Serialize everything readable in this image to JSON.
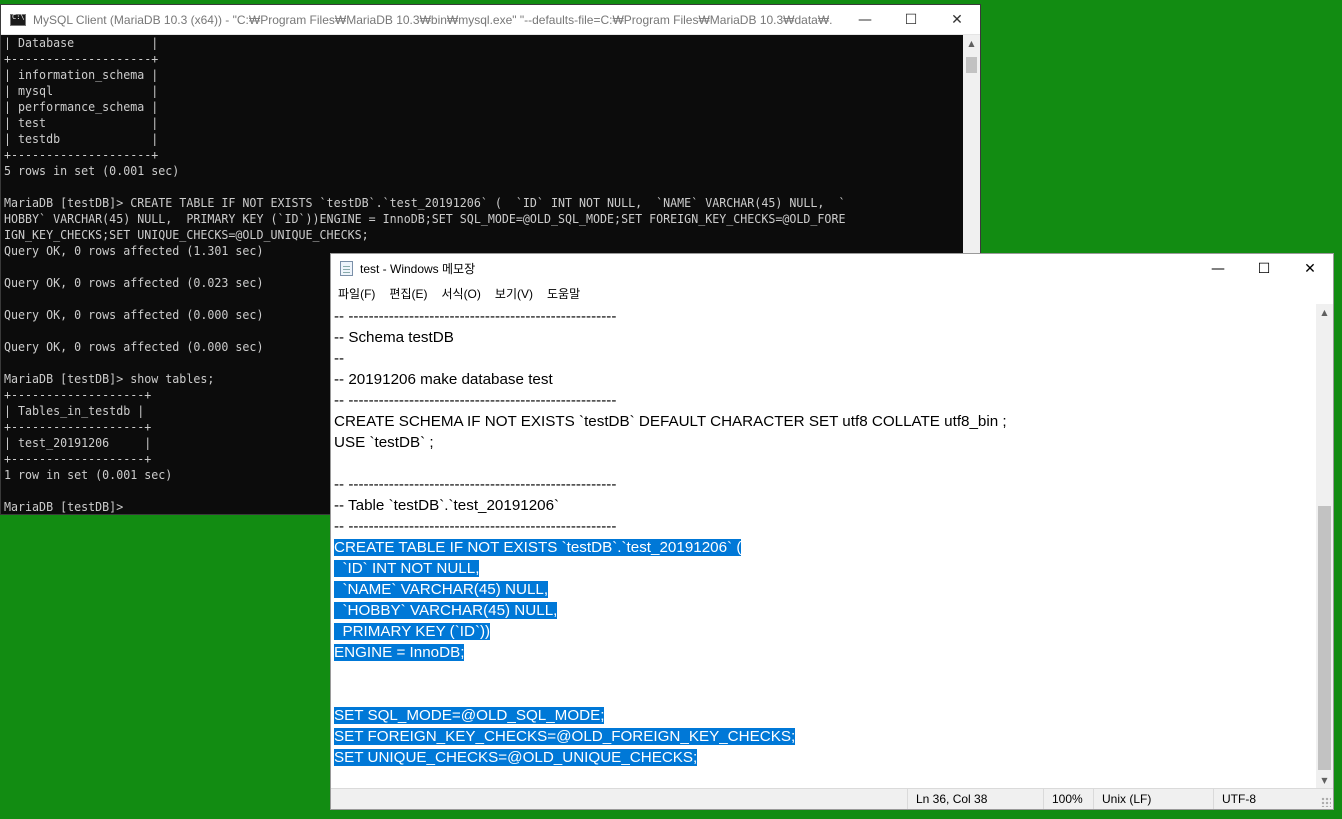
{
  "console": {
    "title": "MySQL Client (MariaDB 10.3 (x64)) - \"C:₩Program Files₩MariaDB 10.3₩bin₩mysql.exe\"  \"--defaults-file=C:₩Program Files₩MariaDB 10.3₩data₩...",
    "controls": {
      "minimize": "—",
      "maximize": "☐",
      "close": "✕"
    },
    "lines": [
      "| Database           |",
      "+--------------------+",
      "| information_schema |",
      "| mysql              |",
      "| performance_schema |",
      "| test               |",
      "| testdb             |",
      "+--------------------+",
      "5 rows in set (0.001 sec)",
      "",
      "MariaDB [testDB]> CREATE TABLE IF NOT EXISTS `testDB`.`test_20191206` (  `ID` INT NOT NULL,  `NAME` VARCHAR(45) NULL,  `",
      "HOBBY` VARCHAR(45) NULL,  PRIMARY KEY (`ID`))ENGINE = InnoDB;SET SQL_MODE=@OLD_SQL_MODE;SET FOREIGN_KEY_CHECKS=@OLD_FORE",
      "IGN_KEY_CHECKS;SET UNIQUE_CHECKS=@OLD_UNIQUE_CHECKS;",
      "Query OK, 0 rows affected (1.301 sec)",
      "",
      "Query OK, 0 rows affected (0.023 sec)",
      "",
      "Query OK, 0 rows affected (0.000 sec)",
      "",
      "Query OK, 0 rows affected (0.000 sec)",
      "",
      "MariaDB [testDB]> show tables;",
      "+-------------------+",
      "| Tables_in_testdb |",
      "+-------------------+",
      "| test_20191206     |",
      "+-------------------+",
      "1 row in set (0.001 sec)",
      "",
      "MariaDB [testDB]>"
    ]
  },
  "notepad": {
    "title": "test - Windows 메모장",
    "controls": {
      "minimize": "—",
      "maximize": "☐",
      "close": "✕"
    },
    "menu": [
      "파일(F)",
      "편집(E)",
      "서식(O)",
      "보기(V)",
      "도움말"
    ],
    "lines": [
      {
        "text": "-- -----------------------------------------------------",
        "selected": false
      },
      {
        "text": "-- Schema testDB",
        "selected": false
      },
      {
        "text": "--",
        "selected": false
      },
      {
        "text": "-- 20191206 make database test",
        "selected": false
      },
      {
        "text": "-- -----------------------------------------------------",
        "selected": false
      },
      {
        "text": "CREATE SCHEMA IF NOT EXISTS `testDB` DEFAULT CHARACTER SET utf8 COLLATE utf8_bin ;",
        "selected": false
      },
      {
        "text": "USE `testDB` ;",
        "selected": false
      },
      {
        "text": "",
        "selected": false
      },
      {
        "text": "-- -----------------------------------------------------",
        "selected": false
      },
      {
        "text": "-- Table `testDB`.`test_20191206`",
        "selected": false
      },
      {
        "text": "-- -----------------------------------------------------",
        "selected": false
      },
      {
        "text": "CREATE TABLE IF NOT EXISTS `testDB`.`test_20191206` (",
        "selected": true
      },
      {
        "text": "  `ID` INT NOT NULL,",
        "selected": true
      },
      {
        "text": "  `NAME` VARCHAR(45) NULL,",
        "selected": true
      },
      {
        "text": "  `HOBBY` VARCHAR(45) NULL,",
        "selected": true
      },
      {
        "text": "  PRIMARY KEY (`ID`))",
        "selected": true
      },
      {
        "text": "ENGINE = InnoDB;",
        "selected": true
      },
      {
        "text": "",
        "selected": true
      },
      {
        "text": "",
        "selected": true
      },
      {
        "text": "SET SQL_MODE=@OLD_SQL_MODE;",
        "selected": true
      },
      {
        "text": "SET FOREIGN_KEY_CHECKS=@OLD_FOREIGN_KEY_CHECKS;",
        "selected": true
      },
      {
        "text": "SET UNIQUE_CHECKS=@OLD_UNIQUE_CHECKS;",
        "selected": true
      }
    ],
    "status": {
      "position": "Ln 36, Col 38",
      "zoom": "100%",
      "line_ending": "Unix (LF)",
      "encoding": "UTF-8"
    }
  },
  "colors": {
    "desktop": "#128c12",
    "selection": "#0078d7",
    "console_bg": "#0c0c0c",
    "console_text": "#cccccc"
  }
}
